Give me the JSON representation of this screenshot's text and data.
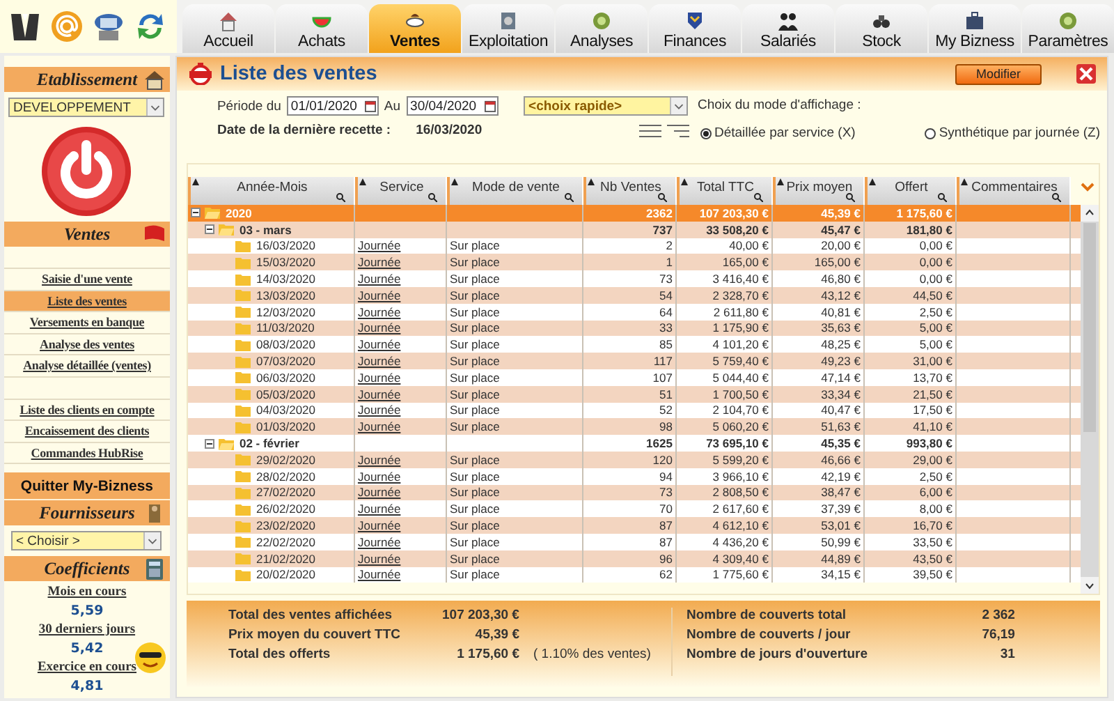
{
  "tabs": [
    {
      "label": "Accueil",
      "selected": false
    },
    {
      "label": "Achats",
      "selected": false
    },
    {
      "label": "Ventes",
      "selected": true
    },
    {
      "label": "Exploitation",
      "selected": false
    },
    {
      "label": "Analyses",
      "selected": false
    },
    {
      "label": "Finances",
      "selected": false
    },
    {
      "label": "Salariés",
      "selected": false
    },
    {
      "label": "Stock",
      "selected": false
    },
    {
      "label": "My Bizness",
      "selected": false
    },
    {
      "label": "Paramètres",
      "selected": false
    }
  ],
  "sidebar": {
    "establishment_title": "Etablissement",
    "establishment_value": "DEVELOPPEMENT",
    "sales_title": "Ventes",
    "sales_groups": [
      [
        {
          "label": "Saisie d'une vente",
          "selected": false
        },
        {
          "label": "Liste des ventes",
          "selected": true
        },
        {
          "label": "Versements en banque",
          "selected": false
        },
        {
          "label": "Analyse des ventes",
          "selected": false
        },
        {
          "label": "Analyse détaillée (ventes)",
          "selected": false
        }
      ],
      [
        {
          "label": "Liste des clients en compte",
          "selected": false
        },
        {
          "label": "Encaissement des clients",
          "selected": false
        },
        {
          "label": "Commandes HubRise",
          "selected": false
        }
      ]
    ],
    "quit": "Quitter My-Bizness",
    "suppliers_title": "Fournisseurs",
    "suppliers_value": "< Choisir >",
    "coefficients_title": "Coefficients",
    "coefficients": [
      {
        "label": "Mois en cours",
        "value": "5,59"
      },
      {
        "label": "30 derniers jours",
        "value": "5,42"
      },
      {
        "label": "Exercice en cours",
        "value": "4,81"
      }
    ]
  },
  "page": {
    "title": "Liste des ventes",
    "modify_button": "Modifier"
  },
  "filters": {
    "period_label": "Période du",
    "from": "01/01/2020",
    "to_label": "Au",
    "to": "30/04/2020",
    "quick_choice": "<choix rapide>",
    "last_receipt_label": "Date de la dernière recette :",
    "last_receipt_value": "16/03/2020"
  },
  "display_mode": {
    "label": "Choix du mode d'affichage :",
    "options": [
      {
        "label": "Détaillée par service (X)",
        "selected": true
      },
      {
        "label": "Synthétique par journée (Z)",
        "selected": false
      }
    ]
  },
  "table": {
    "columns": [
      "Année-Mois",
      "Service",
      "Mode de vente",
      "Nb Ventes",
      "Total TTC",
      "Prix moyen",
      "Offert",
      "Commentaires"
    ],
    "rows": [
      {
        "kind": "year",
        "label": "2020",
        "expanded": true,
        "nb": "2362",
        "total": "107 203,30 €",
        "avg": "45,39 €",
        "offered": "1 175,60 €",
        "children": [
          {
            "kind": "month",
            "label": "03 - mars",
            "expanded": true,
            "nb": "737",
            "total": "33 508,20 €",
            "avg": "45,47 €",
            "offered": "181,80 €",
            "children": [
              {
                "kind": "day",
                "label": "16/03/2020",
                "service": "Journée",
                "mode": "Sur place",
                "nb": "2",
                "total": "40,00 €",
                "avg": "20,00 €",
                "offered": "0,00 €"
              },
              {
                "kind": "day",
                "label": "15/03/2020",
                "service": "Journée",
                "mode": "Sur place",
                "nb": "1",
                "total": "165,00 €",
                "avg": "165,00 €",
                "offered": "0,00 €"
              },
              {
                "kind": "day",
                "label": "14/03/2020",
                "service": "Journée",
                "mode": "Sur place",
                "nb": "73",
                "total": "3 416,40 €",
                "avg": "46,80 €",
                "offered": "0,00 €"
              },
              {
                "kind": "day",
                "label": "13/03/2020",
                "service": "Journée",
                "mode": "Sur place",
                "nb": "54",
                "total": "2 328,70 €",
                "avg": "43,12 €",
                "offered": "44,50 €"
              },
              {
                "kind": "day",
                "label": "12/03/2020",
                "service": "Journée",
                "mode": "Sur place",
                "nb": "64",
                "total": "2 611,80 €",
                "avg": "40,81 €",
                "offered": "2,50 €"
              },
              {
                "kind": "day",
                "label": "11/03/2020",
                "service": "Journée",
                "mode": "Sur place",
                "nb": "33",
                "total": "1 175,90 €",
                "avg": "35,63 €",
                "offered": "5,00 €"
              },
              {
                "kind": "day",
                "label": "08/03/2020",
                "service": "Journée",
                "mode": "Sur place",
                "nb": "85",
                "total": "4 101,20 €",
                "avg": "48,25 €",
                "offered": "5,00 €"
              },
              {
                "kind": "day",
                "label": "07/03/2020",
                "service": "Journée",
                "mode": "Sur place",
                "nb": "117",
                "total": "5 759,40 €",
                "avg": "49,23 €",
                "offered": "31,00 €"
              },
              {
                "kind": "day",
                "label": "06/03/2020",
                "service": "Journée",
                "mode": "Sur place",
                "nb": "107",
                "total": "5 044,40 €",
                "avg": "47,14 €",
                "offered": "13,70 €"
              },
              {
                "kind": "day",
                "label": "05/03/2020",
                "service": "Journée",
                "mode": "Sur place",
                "nb": "51",
                "total": "1 700,50 €",
                "avg": "33,34 €",
                "offered": "21,50 €"
              },
              {
                "kind": "day",
                "label": "04/03/2020",
                "service": "Journée",
                "mode": "Sur place",
                "nb": "52",
                "total": "2 104,70 €",
                "avg": "40,47 €",
                "offered": "17,50 €"
              },
              {
                "kind": "day",
                "label": "01/03/2020",
                "service": "Journée",
                "mode": "Sur place",
                "nb": "98",
                "total": "5 060,20 €",
                "avg": "51,63 €",
                "offered": "41,10 €"
              }
            ]
          },
          {
            "kind": "month",
            "label": "02 - février",
            "expanded": true,
            "nb": "1625",
            "total": "73 695,10 €",
            "avg": "45,35 €",
            "offered": "993,80 €",
            "children": [
              {
                "kind": "day",
                "label": "29/02/2020",
                "service": "Journée",
                "mode": "Sur place",
                "nb": "120",
                "total": "5 599,20 €",
                "avg": "46,66 €",
                "offered": "29,00 €"
              },
              {
                "kind": "day",
                "label": "28/02/2020",
                "service": "Journée",
                "mode": "Sur place",
                "nb": "94",
                "total": "3 966,10 €",
                "avg": "42,19 €",
                "offered": "2,50 €"
              },
              {
                "kind": "day",
                "label": "27/02/2020",
                "service": "Journée",
                "mode": "Sur place",
                "nb": "73",
                "total": "2 808,50 €",
                "avg": "38,47 €",
                "offered": "6,00 €"
              },
              {
                "kind": "day",
                "label": "26/02/2020",
                "service": "Journée",
                "mode": "Sur place",
                "nb": "70",
                "total": "2 617,60 €",
                "avg": "37,39 €",
                "offered": "8,00 €"
              },
              {
                "kind": "day",
                "label": "23/02/2020",
                "service": "Journée",
                "mode": "Sur place",
                "nb": "87",
                "total": "4 612,10 €",
                "avg": "53,01 €",
                "offered": "16,70 €"
              },
              {
                "kind": "day",
                "label": "22/02/2020",
                "service": "Journée",
                "mode": "Sur place",
                "nb": "87",
                "total": "4 436,20 €",
                "avg": "50,99 €",
                "offered": "33,50 €"
              },
              {
                "kind": "day",
                "label": "21/02/2020",
                "service": "Journée",
                "mode": "Sur place",
                "nb": "96",
                "total": "4 309,40 €",
                "avg": "44,89 €",
                "offered": "43,50 €"
              },
              {
                "kind": "day",
                "label": "20/02/2020",
                "service": "Journée",
                "mode": "Sur place",
                "nb": "62",
                "total": "1 775,60 €",
                "avg": "34,15 €",
                "offered": "39,50 €"
              }
            ]
          }
        ]
      }
    ]
  },
  "summary": {
    "left": [
      {
        "label": "Total des ventes affichées",
        "value": "107 203,30 €"
      },
      {
        "label": "Prix moyen du couvert TTC",
        "value": "45,39 €"
      },
      {
        "label": "Total des offerts",
        "value": "1 175,60 €",
        "note": "( 1.10% des ventes)"
      }
    ],
    "right": [
      {
        "label": "Nombre de couverts total",
        "value": "2 362"
      },
      {
        "label": "Nombre de couverts / jour",
        "value": "76,19"
      },
      {
        "label": "Nombre de jours d'ouverture",
        "value": "31"
      }
    ]
  }
}
